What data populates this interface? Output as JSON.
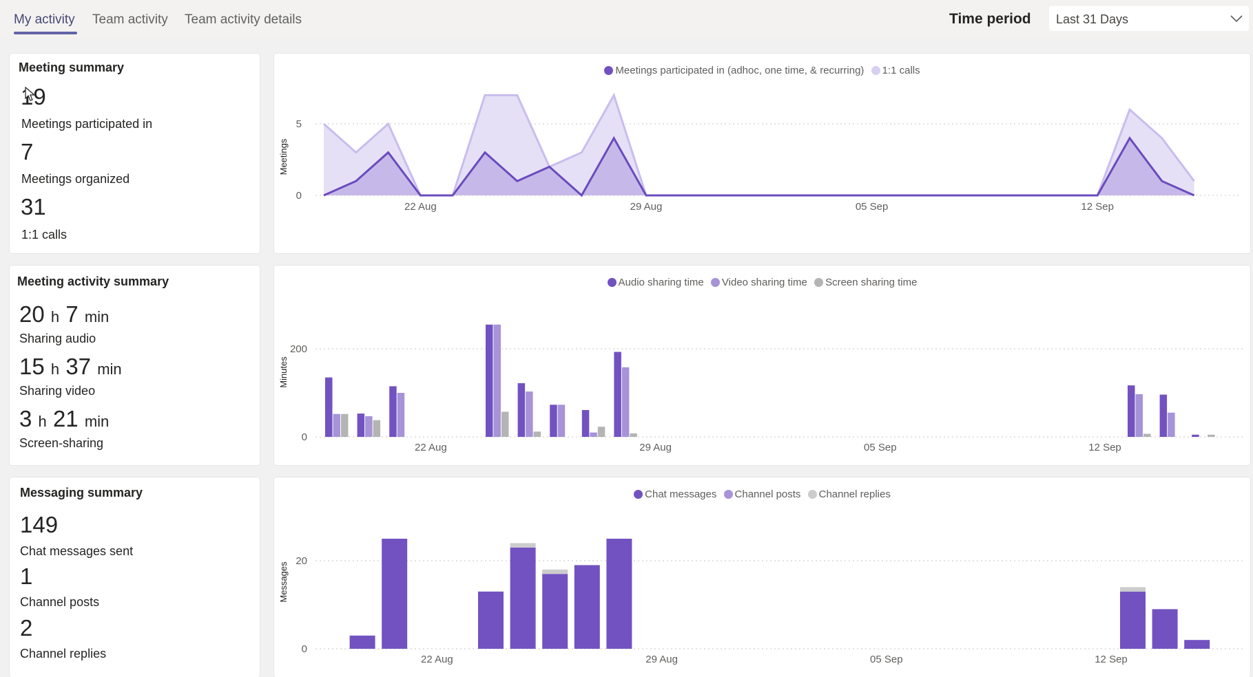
{
  "tabs": {
    "my_activity": "My activity",
    "team_activity": "Team activity",
    "team_activity_details": "Team activity details"
  },
  "time_period": {
    "label": "Time period",
    "value": "Last 31 Days"
  },
  "colors": {
    "primary": "#7252c1",
    "secondary": "#a693d8",
    "light": "#d8d0f0",
    "gray": "#b4b4b4",
    "accent": "#6264a7"
  },
  "meeting_summary": {
    "title": "Meeting summary",
    "participated_value": "19",
    "participated_label": "Meetings participated in",
    "organized_value": "7",
    "organized_label": "Meetings organized",
    "calls_value": "31",
    "calls_label": "1:1 calls"
  },
  "activity_summary": {
    "title": "Meeting activity summary",
    "audio_h": "20",
    "audio_m": "7",
    "audio_label": "Sharing audio",
    "video_h": "15",
    "video_m": "37",
    "video_label": "Sharing video",
    "screen_h": "3",
    "screen_m": "21",
    "screen_label": "Screen-sharing",
    "unit_h": "h",
    "unit_min": "min"
  },
  "messaging_summary": {
    "title": "Messaging summary",
    "chat_value": "149",
    "chat_label": "Chat messages sent",
    "posts_value": "1",
    "posts_label": "Channel posts",
    "replies_value": "2",
    "replies_label": "Channel replies"
  },
  "chart_data": [
    {
      "type": "area",
      "ylabel": "Meetings",
      "ylim": [
        0,
        7
      ],
      "yticks": [
        0,
        5
      ],
      "x_days": 29,
      "xtick_labels": [
        {
          "day": 3,
          "label": "22 Aug"
        },
        {
          "day": 10,
          "label": "29 Aug"
        },
        {
          "day": 17,
          "label": "05 Sep"
        },
        {
          "day": 24,
          "label": "12 Sep"
        }
      ],
      "series": [
        {
          "name": "Meetings participated in (adhoc, one time, & recurring)",
          "color": "#7252c1",
          "values": [
            0,
            1,
            3,
            0,
            0,
            3,
            1,
            2,
            0,
            4,
            0,
            0,
            0,
            0,
            0,
            0,
            0,
            0,
            0,
            0,
            0,
            0,
            0,
            0,
            0,
            4,
            1,
            0
          ]
        },
        {
          "name": "1:1 calls",
          "color": "#d8d0f0",
          "values": [
            5,
            3,
            5,
            0,
            0,
            7,
            7,
            2,
            3,
            7,
            0,
            0,
            0,
            0,
            0,
            0,
            0,
            0,
            0,
            0,
            0,
            0,
            0,
            0,
            0,
            6,
            4,
            1
          ]
        }
      ]
    },
    {
      "type": "bar",
      "ylabel": "Minutes",
      "ylim": [
        0,
        250
      ],
      "yticks": [
        0,
        200
      ],
      "xtick_labels": [
        {
          "day": 4,
          "label": "22 Aug"
        },
        {
          "day": 11,
          "label": "29 Aug"
        },
        {
          "day": 18,
          "label": "05 Sep"
        },
        {
          "day": 25,
          "label": "12 Sep"
        }
      ],
      "series": [
        {
          "name": "Audio sharing time",
          "color": "#7252c1",
          "values": [
            135,
            53,
            115,
            0,
            0,
            255,
            122,
            73,
            61,
            193,
            0,
            0,
            0,
            0,
            0,
            0,
            0,
            0,
            0,
            0,
            0,
            0,
            0,
            0,
            0,
            117,
            96,
            5
          ]
        },
        {
          "name": "Video sharing time",
          "color": "#a693d8",
          "values": [
            52,
            47,
            100,
            0,
            0,
            255,
            103,
            73,
            10,
            158,
            0,
            0,
            0,
            0,
            0,
            0,
            0,
            0,
            0,
            0,
            0,
            0,
            0,
            0,
            0,
            97,
            55,
            0
          ]
        },
        {
          "name": "Screen sharing time",
          "color": "#b4b4b4",
          "values": [
            52,
            38,
            0,
            0,
            0,
            57,
            12,
            0,
            23,
            8,
            0,
            0,
            0,
            0,
            0,
            0,
            0,
            0,
            0,
            0,
            0,
            0,
            0,
            0,
            0,
            7,
            0,
            5
          ]
        }
      ]
    },
    {
      "type": "bar",
      "stacked": true,
      "ylabel": "Messages",
      "ylim": [
        0,
        26
      ],
      "yticks": [
        0,
        20
      ],
      "xtick_labels": [
        {
          "day": 4,
          "label": "22 Aug"
        },
        {
          "day": 11,
          "label": "29 Aug"
        },
        {
          "day": 18,
          "label": "05 Sep"
        },
        {
          "day": 25,
          "label": "12 Sep"
        }
      ],
      "series": [
        {
          "name": "Chat messages",
          "color": "#7252c1",
          "values": [
            0,
            3,
            25,
            0,
            0,
            13,
            23,
            17,
            19,
            25,
            0,
            0,
            0,
            0,
            0,
            0,
            0,
            0,
            0,
            0,
            0,
            0,
            0,
            0,
            0,
            13,
            9,
            2
          ]
        },
        {
          "name": "Channel posts",
          "color": "#a693d8",
          "values": [
            0,
            0,
            0,
            0,
            0,
            0,
            0,
            0,
            0,
            0,
            0,
            0,
            0,
            0,
            0,
            0,
            0,
            0,
            0,
            0,
            0,
            0,
            0,
            0,
            0,
            0,
            0,
            0
          ]
        },
        {
          "name": "Channel replies",
          "color": "#cccccc",
          "values": [
            0,
            0,
            0,
            0,
            0,
            0,
            1,
            1,
            0,
            0,
            0,
            0,
            0,
            0,
            0,
            0,
            0,
            0,
            0,
            0,
            0,
            0,
            0,
            0,
            0,
            1,
            0,
            0
          ]
        }
      ]
    }
  ]
}
